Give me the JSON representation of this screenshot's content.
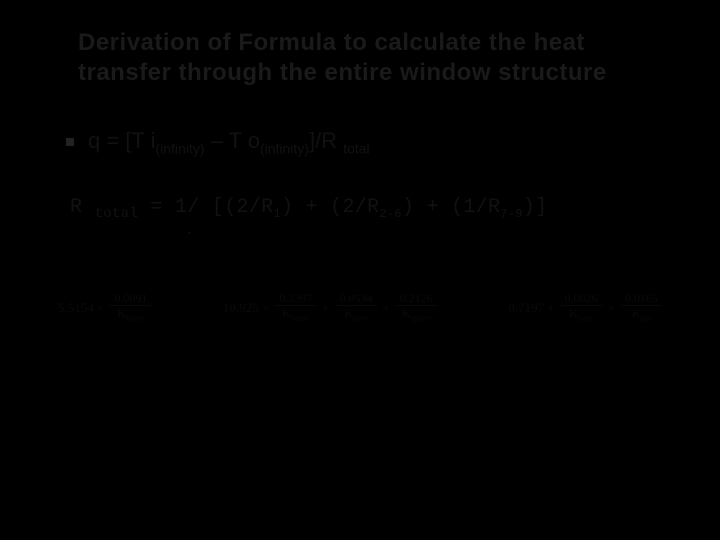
{
  "title": "Derivation of Formula to calculate the heat transfer through the entire window structure",
  "eq1": {
    "lead": "q = [T i",
    "sub1": "(infinity)",
    "mid": " – T o",
    "sub2": "(infinity)",
    "tail1": "]/R ",
    "tail_sub": "total"
  },
  "rtotal": {
    "lhs": "R ",
    "lhs_sub": "total",
    "rhs_a": " = 1/ [(2/R",
    "s1": "1",
    "rhs_b": ") + (2/R",
    "s2": "2-6",
    "rhs_c": ") + (1/R",
    "s3": "7-9",
    "rhs_d": ")]"
  },
  "dot": "•",
  "terms": [
    {
      "coef": "5.5154 +",
      "fracs": [
        {
          "num": "0.0091",
          "den_k": "frame"
        }
      ]
    },
    {
      "coef": "10.925 +",
      "fracs": [
        {
          "num": "0.3397",
          "den_k": "frame"
        },
        {
          "plus": "+"
        },
        {
          "num": "0.0534",
          "den_k": "pane"
        },
        {
          "plus": "+"
        },
        {
          "num": "0.2126",
          "den_k": "spacer"
        }
      ]
    },
    {
      "coef": "0.7197 +",
      "fracs": [
        {
          "num": "0.0826",
          "den_k": "pane"
        },
        {
          "plus": "+"
        },
        {
          "num": "0.0165",
          "den_k": "gas"
        }
      ]
    }
  ]
}
